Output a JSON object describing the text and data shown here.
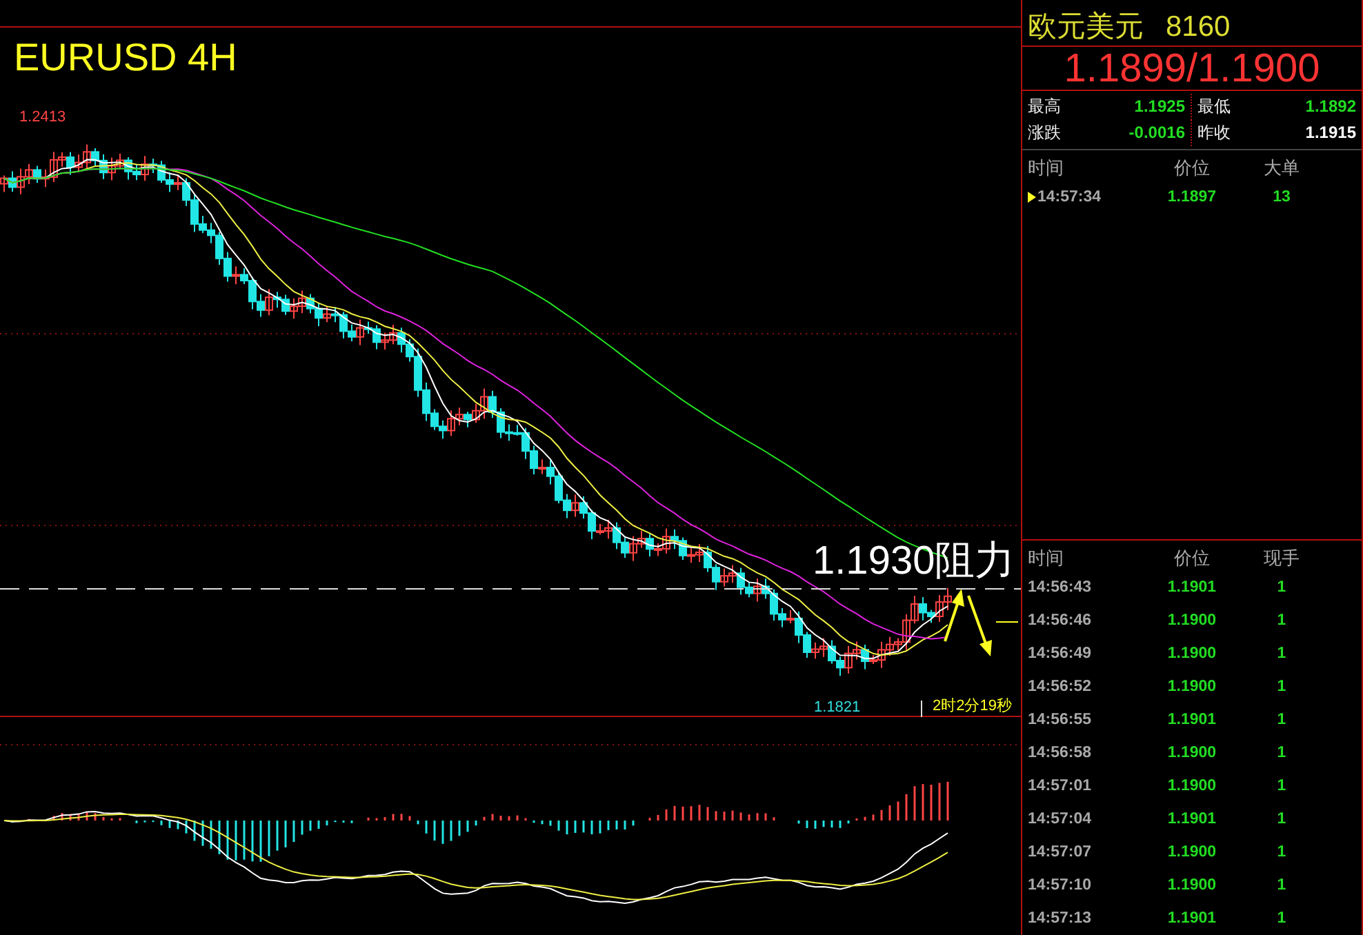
{
  "chart": {
    "title": "EURUSD 4H",
    "high_label": "1.2413",
    "low_label": "1.1821",
    "annotation": "1.1930阻力",
    "countdown": "2时2分19秒"
  },
  "quote": {
    "name": "欧元美元",
    "code": "8160",
    "price": "1.1899/1.1900",
    "stats": [
      {
        "label": "最高",
        "value": "1.1925",
        "color": "#22dd22"
      },
      {
        "label": "最低",
        "value": "1.1892",
        "color": "#22dd22"
      },
      {
        "label": "涨跌",
        "value": "-0.0016",
        "color": "#22dd22"
      },
      {
        "label": "昨收",
        "value": "1.1915",
        "color": "#ffffff"
      }
    ]
  },
  "big_orders": {
    "columns": [
      "时间",
      "价位",
      "大单"
    ],
    "rows": [
      {
        "time": "14:57:34",
        "price": "1.1897",
        "size": "13",
        "selected": true
      }
    ]
  },
  "ticks": {
    "columns": [
      "时间",
      "价位",
      "现手"
    ],
    "rows": [
      {
        "time": "14:56:43",
        "price": "1.1901",
        "size": "1"
      },
      {
        "time": "14:56:46",
        "price": "1.1900",
        "size": "1"
      },
      {
        "time": "14:56:49",
        "price": "1.1900",
        "size": "1"
      },
      {
        "time": "14:56:52",
        "price": "1.1900",
        "size": "1"
      },
      {
        "time": "14:56:55",
        "price": "1.1901",
        "size": "1"
      },
      {
        "time": "14:56:58",
        "price": "1.1900",
        "size": "1"
      },
      {
        "time": "14:57:01",
        "price": "1.1900",
        "size": "1"
      },
      {
        "time": "14:57:04",
        "price": "1.1901",
        "size": "1"
      },
      {
        "time": "14:57:07",
        "price": "1.1900",
        "size": "1"
      },
      {
        "time": "14:57:10",
        "price": "1.1900",
        "size": "1"
      },
      {
        "time": "14:57:13",
        "price": "1.1901",
        "size": "1"
      }
    ]
  }
}
